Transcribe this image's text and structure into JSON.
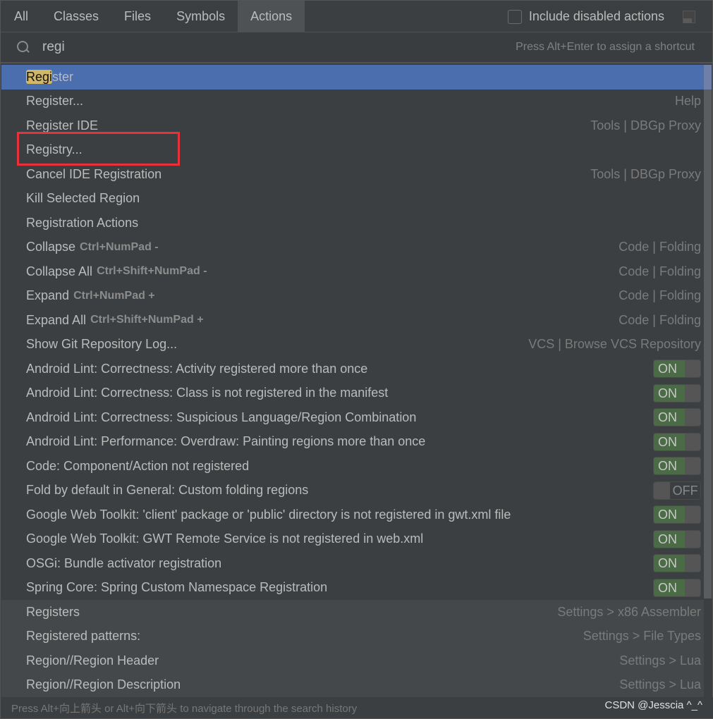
{
  "tabs": [
    "All",
    "Classes",
    "Files",
    "Symbols",
    "Actions"
  ],
  "active_tab": "Actions",
  "include_disabled": {
    "label": "Include disabled actions",
    "checked": false
  },
  "search": {
    "value": "regi",
    "hint": "Press Alt+Enter to assign a shortcut",
    "highlight": "Regi"
  },
  "results": [
    {
      "name": "Register",
      "right": "",
      "selected": true
    },
    {
      "name": "Register...",
      "right": "Help"
    },
    {
      "name": "Register IDE",
      "right": "Tools | DBGp Proxy"
    },
    {
      "name": "Registry...",
      "right": "",
      "boxed": true
    },
    {
      "name": "Cancel IDE Registration",
      "right": "Tools | DBGp Proxy"
    },
    {
      "name": "Kill Selected Region",
      "right": ""
    },
    {
      "name": "Registration Actions",
      "right": ""
    },
    {
      "name": "Collapse",
      "shortcut": "Ctrl+NumPad -",
      "right": "Code | Folding"
    },
    {
      "name": "Collapse All",
      "shortcut": "Ctrl+Shift+NumPad -",
      "right": "Code | Folding"
    },
    {
      "name": "Expand",
      "shortcut": "Ctrl+NumPad +",
      "right": "Code | Folding"
    },
    {
      "name": "Expand All",
      "shortcut": "Ctrl+Shift+NumPad +",
      "right": "Code | Folding"
    },
    {
      "name": "Show Git Repository Log...",
      "right": "VCS | Browse VCS Repository"
    },
    {
      "name": "Android Lint: Correctness: Activity registered more than once",
      "toggle": "ON"
    },
    {
      "name": "Android Lint: Correctness: Class is not registered in the manifest",
      "toggle": "ON"
    },
    {
      "name": "Android Lint: Correctness: Suspicious Language/Region Combination",
      "toggle": "ON"
    },
    {
      "name": "Android Lint: Performance: Overdraw: Painting regions more than once",
      "toggle": "ON"
    },
    {
      "name": "Code: Component/Action not registered",
      "toggle": "ON"
    },
    {
      "name": "Fold by default in General: Custom folding regions",
      "toggle": "OFF"
    },
    {
      "name": "Google Web Toolkit: 'client' package or 'public' directory is not registered in gwt.xml file",
      "toggle": "ON"
    },
    {
      "name": "Google Web Toolkit: GWT Remote Service is not registered in web.xml",
      "toggle": "ON"
    },
    {
      "name": "OSGi: Bundle activator registration",
      "toggle": "ON"
    },
    {
      "name": "Spring Core: Spring Custom Namespace Registration",
      "toggle": "ON"
    },
    {
      "name": "Registers",
      "right": "Settings > x86 Assembler",
      "settings": true
    },
    {
      "name": "Registered patterns:",
      "right": "Settings > File Types",
      "settings": true
    },
    {
      "name": "Region//Region Header",
      "right": "Settings > Lua",
      "settings": true
    },
    {
      "name": "Region//Region Description",
      "right": "Settings > Lua",
      "settings": true
    }
  ],
  "footer": "Press Alt+向上箭头 or Alt+向下箭头 to navigate through the search history",
  "watermark": "CSDN @Jesscia ^_^",
  "colors": {
    "selection": "#4b6eaf",
    "highlight": "#d1b766",
    "toggle_on": "#4b6b46",
    "annotation_box": "#e8323a"
  }
}
